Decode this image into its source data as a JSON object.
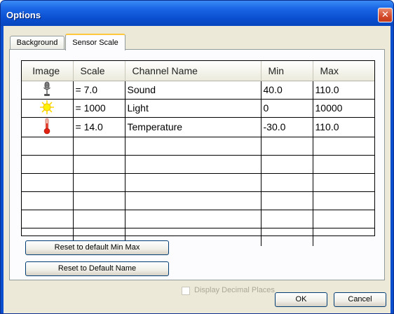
{
  "window": {
    "title": "Options",
    "close_glyph": "✕"
  },
  "tabs": [
    {
      "label": "Background"
    },
    {
      "label": "Sensor Scale"
    }
  ],
  "table": {
    "columns": [
      "Image",
      "Scale",
      "Channel Name",
      "Min",
      "Max"
    ],
    "rows": [
      {
        "icon": "microphone-icon",
        "scale": "= 7.0",
        "channel": "Sound",
        "min": "40.0",
        "max": "110.0"
      },
      {
        "icon": "sun-icon",
        "scale": "= 1000",
        "channel": "Light",
        "min": "0",
        "max": "10000"
      },
      {
        "icon": "thermometer-icon",
        "scale": "= 14.0",
        "channel": "Temperature",
        "min": "-30.0",
        "max": "110.0"
      }
    ],
    "empty_rows": 6
  },
  "buttons": {
    "reset_min_max": "Reset to default Min Max",
    "reset_name": "Reset to Default Name",
    "ok": "OK",
    "cancel": "Cancel"
  },
  "checkbox": {
    "label": "Display Decimal Places",
    "checked": false,
    "enabled": false
  },
  "colors": {
    "titlebar": "#0a4fd0",
    "dialog_bg": "#ece9d8",
    "tab_highlight": "#ffc83c"
  }
}
